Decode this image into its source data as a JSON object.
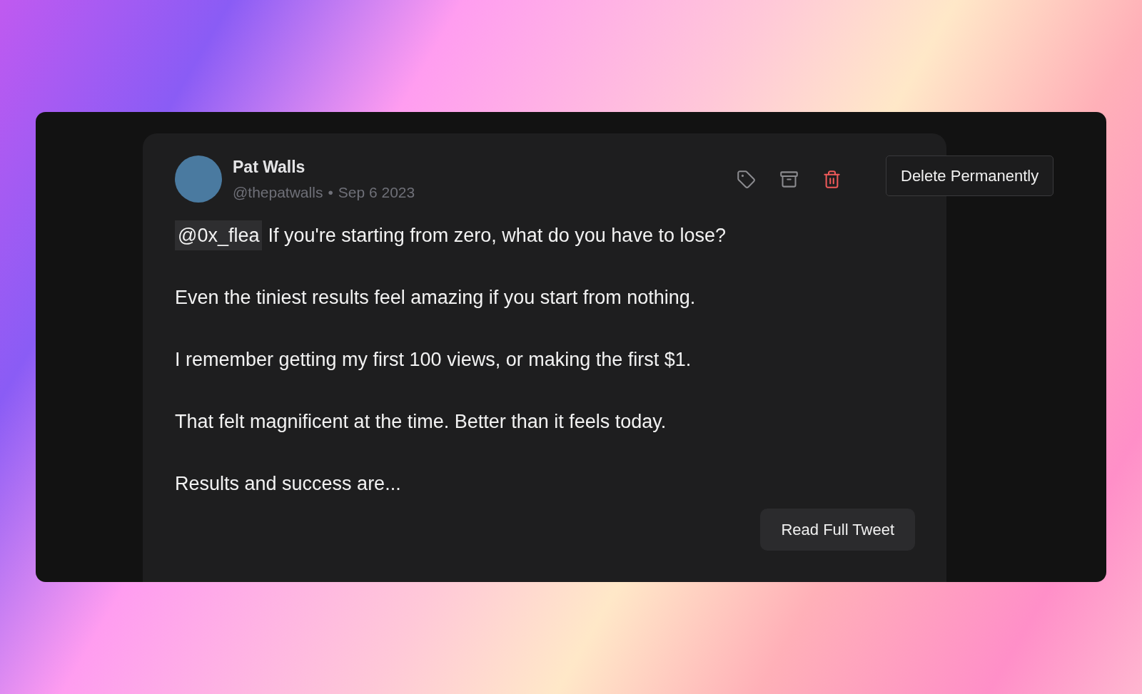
{
  "tweet": {
    "author": "Pat Walls",
    "handle": "@thepatwalls",
    "separator": "•",
    "date": "Sep 6 2023",
    "actions": [
      {
        "kind": "tag",
        "highlighted": false
      },
      {
        "kind": "archive",
        "highlighted": false
      },
      {
        "kind": "delete",
        "highlighted": true
      }
    ],
    "tooltip": "Delete Permanently",
    "mention": "@0x_flea",
    "paragraphs": [
      "If you're starting from zero, what do you have to lose?",
      "Even the tiniest results feel amazing if you start from nothing.",
      "I remember getting my first 100 views, or making the first $1.",
      "That felt magnificent at the time. Better than it feels today.",
      "Results and success are..."
    ],
    "button": "Read Full Tweet"
  }
}
